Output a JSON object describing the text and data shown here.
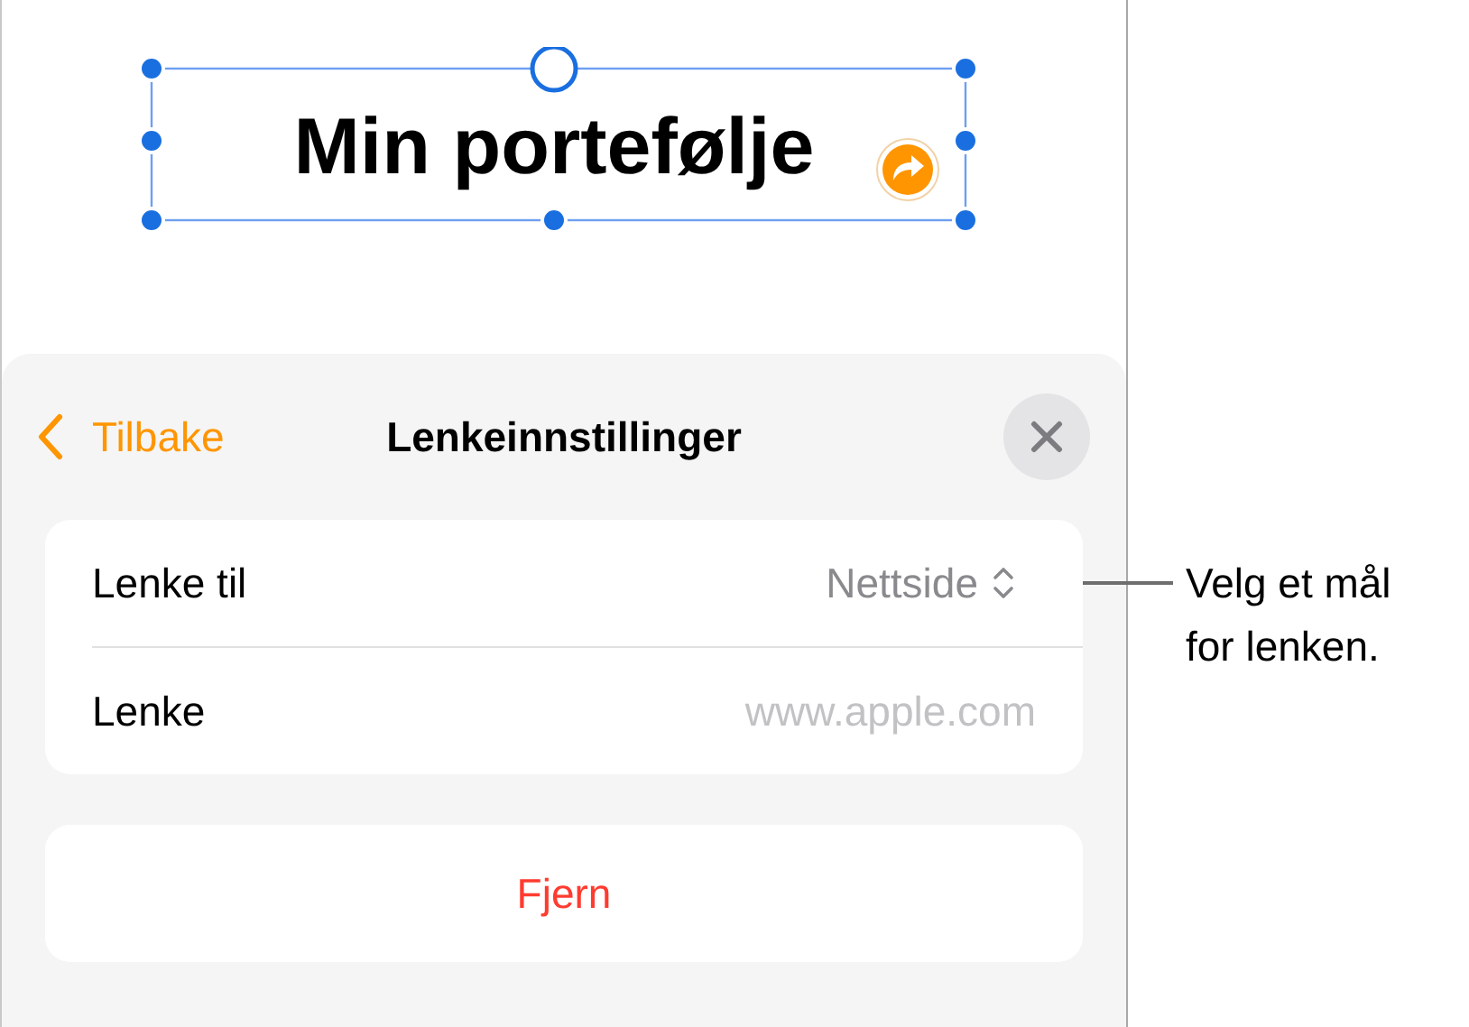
{
  "canvas": {
    "title": "Min portefølje"
  },
  "sheet": {
    "back": "Tilbake",
    "title": "Lenkeinnstillinger"
  },
  "rows": [
    {
      "kind": "picker",
      "label": "Lenke til",
      "value": "Nettside"
    },
    {
      "kind": "field",
      "label": "Lenke",
      "placeholder": "www.apple.com"
    }
  ],
  "remove_button": "Fjern",
  "callout": "Velg et mål for lenken."
}
